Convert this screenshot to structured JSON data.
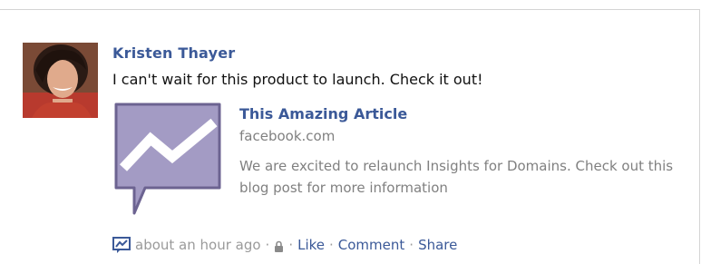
{
  "post": {
    "author": "Kristen Thayer",
    "message": "I can't wait for this product to launch. Check it out!",
    "attachment": {
      "title": "This Amazing Article",
      "domain": "facebook.com",
      "description": "We are excited to relaunch Insights for Domains. Check out this blog post for more information",
      "thumbnail_icon": "insights-chart-icon"
    },
    "meta": {
      "timestamp": "about an hour ago",
      "separator": "·",
      "privacy_icon": "lock-icon",
      "app_icon": "insights-icon",
      "like_label": "Like",
      "comment_label": "Comment",
      "share_label": "Share"
    }
  },
  "colors": {
    "link": "#3b5998",
    "secondary_text": "#808080",
    "thumbnail_fill": "#a39bc4",
    "thumbnail_border": "#6c6391"
  }
}
